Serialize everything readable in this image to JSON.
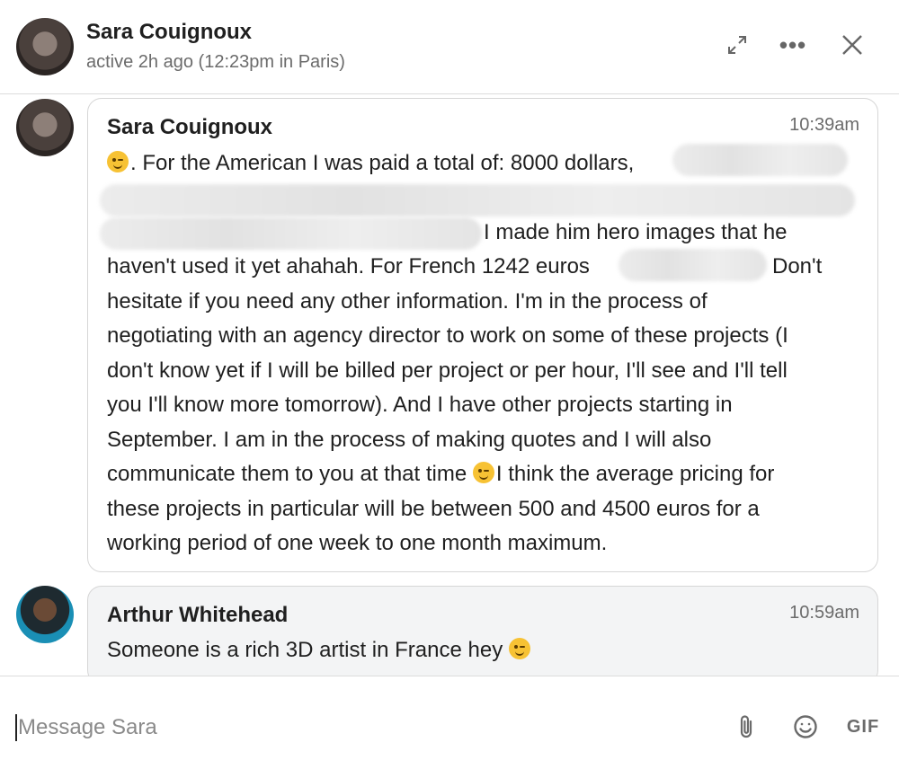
{
  "header": {
    "name": "Sara Couignoux",
    "status": "active 2h ago (12:23pm in Paris)",
    "more_label": "•••"
  },
  "messages": [
    {
      "sender": "Sara Couignoux",
      "time": "10:39am",
      "lines": [
        ". For the American I was paid a total of: 8000 dollars,",
        "I made him hero images that he",
        "haven't used it yet ahahah. For French 1242 euros",
        "Don't",
        "hesitate if you need any other information. I'm in the process of",
        "negotiating with an agency director to work on some of these projects (I",
        "don't know yet if I will be billed per project or per hour, I'll see and I'll tell",
        "you I'll know more tomorrow). And I have other projects starting in",
        "September. I am in the process of making quotes and I will also",
        "communicate them to you at that time",
        "I think the average pricing for",
        "these projects in particular will be between 500 and 4500 euros for a",
        "working period of one week to one month maximum."
      ]
    },
    {
      "sender": "Arthur Whitehead",
      "time": "10:59am",
      "text": "Someone is a rich 3D artist in France hey"
    }
  ],
  "composer": {
    "placeholder": "Message Sara",
    "gif_label": "GIF"
  },
  "icons": {
    "expand": "expand-icon",
    "more": "more-options-icon",
    "close": "close-icon",
    "attach": "paperclip-icon",
    "emoji": "emoji-icon"
  }
}
